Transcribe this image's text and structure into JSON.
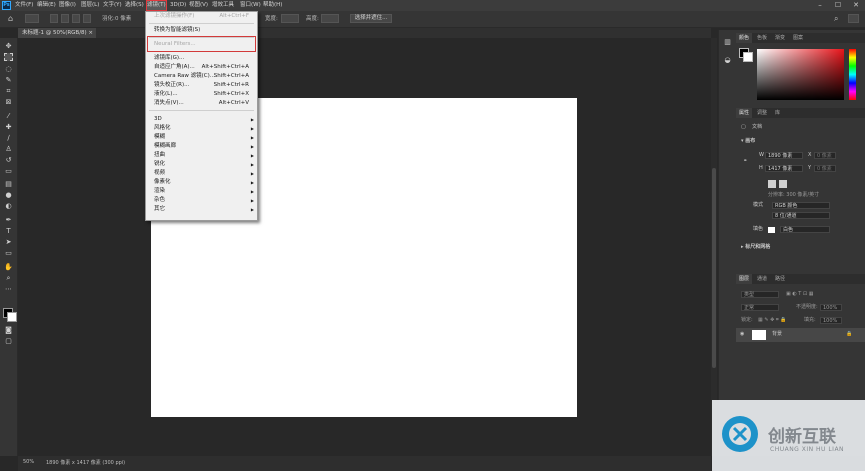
{
  "menubar": {
    "items": [
      "文件(F)",
      "编辑(E)",
      "图像(I)",
      "图层(L)",
      "文字(Y)",
      "选择(S)",
      "滤镜(T)",
      "3D(D)",
      "视图(V)",
      "增效工具",
      "窗口(W)",
      "帮助(H)"
    ],
    "active_index": 6
  },
  "options": {
    "feather_label": "羽化:",
    "feather_value": "0 像素",
    "width_label": "宽度:",
    "height_label": "高度:",
    "select_mask_label": "选择并遮住..."
  },
  "document": {
    "tab_label": "未标题-1 @ 50%(RGB/8)",
    "status_zoom": "50%",
    "status_info": "1890 像素 x 1417 像素 (300 ppi)"
  },
  "filter_menu": {
    "last_filter": {
      "label": "上次滤镜操作(F)",
      "shortcut": "Alt+Ctrl+F"
    },
    "convert_smart": "转换为智能滤镜(S)",
    "neural": "Neural Filters...",
    "group1": [
      {
        "label": "滤镜库(G)...",
        "shortcut": ""
      },
      {
        "label": "自适应广角(A)...",
        "shortcut": "Alt+Shift+Ctrl+A"
      },
      {
        "label": "Camera Raw 滤镜(C)...",
        "shortcut": "Shift+Ctrl+A"
      },
      {
        "label": "镜头校正(R)...",
        "shortcut": "Shift+Ctrl+R"
      },
      {
        "label": "液化(L)...",
        "shortcut": "Shift+Ctrl+X"
      },
      {
        "label": "消失点(V)...",
        "shortcut": "Alt+Ctrl+V"
      }
    ],
    "submenus": [
      "3D",
      "风格化",
      "模糊",
      "模糊画廊",
      "扭曲",
      "锐化",
      "视频",
      "像素化",
      "渲染",
      "杂色",
      "其它"
    ]
  },
  "color_panel": {
    "tabs": [
      "颜色",
      "色板",
      "渐变",
      "图案"
    ]
  },
  "properties_panel": {
    "tabs": [
      "属性",
      "调整",
      "库"
    ],
    "doc_label": "文档",
    "canvas_section": "画布",
    "w_label": "W",
    "w_value": "1890 像素",
    "h_label": "H",
    "h_value": "1417 像素",
    "x_label": "X",
    "x_value": "0 像素",
    "y_label": "Y",
    "y_value": "0 像素",
    "resolution": "分辨率: 300 像素/英寸",
    "mode_label": "模式",
    "mode_value": "RGB 颜色",
    "depth_value": "8 位/通道",
    "fill_label": "填色",
    "fill_value": "白色",
    "rulers_section": "标尺和网格"
  },
  "layers_panel": {
    "tabs": [
      "图层",
      "通道",
      "路径"
    ],
    "search_label": "类型",
    "blend_mode": "正常",
    "opacity_label": "不透明度:",
    "opacity_value": "100%",
    "lock_label": "锁定:",
    "fill_label": "填充:",
    "fill_value": "100%",
    "layer_name": "背景"
  },
  "watermark": {
    "cn": "创新互联",
    "en": "CHUANG XIN HU LIAN"
  },
  "colors": {
    "accent_red": "#d23a3a",
    "ps_blue": "#31a8ff"
  }
}
